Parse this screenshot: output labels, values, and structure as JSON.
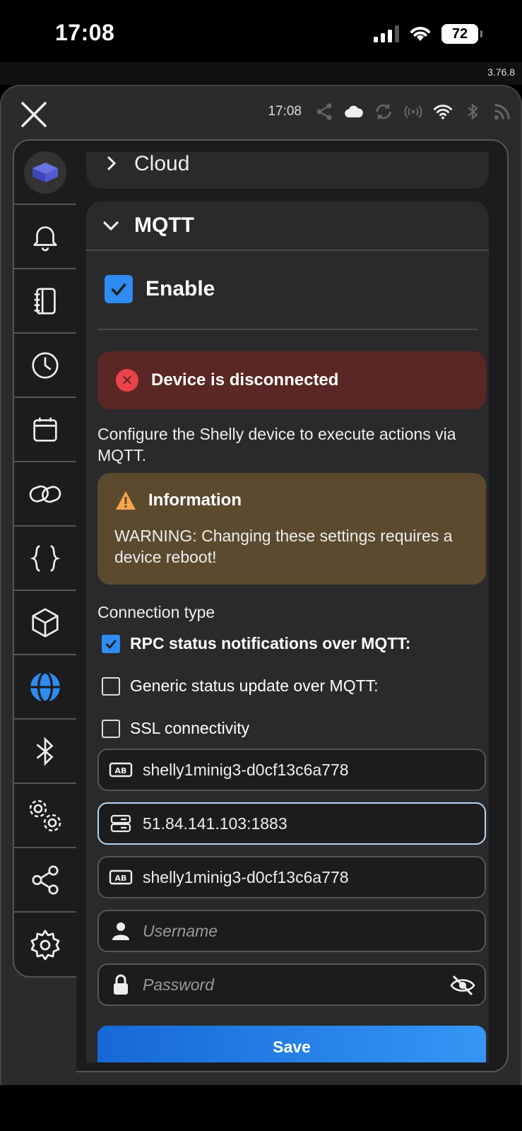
{
  "status_bar": {
    "time": "17:08",
    "battery": "72"
  },
  "app": {
    "version": "3.76.8",
    "header_time": "17:08"
  },
  "sidebar": {
    "items": [
      "device",
      "notifications",
      "logs",
      "schedules",
      "calendar",
      "actions",
      "scripts",
      "components",
      "network",
      "bluetooth",
      "advanced-settings",
      "share",
      "settings"
    ],
    "active": "network"
  },
  "cloud": {
    "title": "Cloud"
  },
  "mqtt": {
    "title": "MQTT",
    "enable_label": "Enable",
    "error": "Device is disconnected",
    "description": "Configure the Shelly device to execute actions via MQTT.",
    "info_title": "Information",
    "info_body": "WARNING: Changing these settings requires a device reboot!",
    "connection_type_label": "Connection type",
    "options": [
      {
        "label": "RPC status notifications over MQTT:",
        "checked": true
      },
      {
        "label": "Generic status update over MQTT:",
        "checked": false
      },
      {
        "label": "SSL connectivity",
        "checked": false
      }
    ],
    "client_id": "shelly1minig3-d0cf13c6a778",
    "server": "51.84.141.103:1883",
    "topic_prefix": "shelly1minig3-d0cf13c6a778",
    "username_placeholder": "Username",
    "password_placeholder": "Password",
    "save_label": "Save"
  },
  "colors": {
    "accent": "#2f8cf0",
    "error_bg": "#5a2724",
    "info_bg": "#5c4a2f"
  }
}
